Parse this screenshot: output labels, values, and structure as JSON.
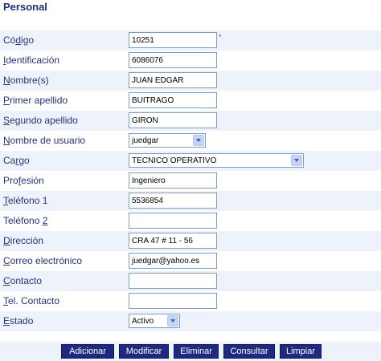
{
  "page": {
    "title": "Personal"
  },
  "form": {
    "codigo": {
      "label_pre": "Có",
      "label_u": "d",
      "label_post": "igo",
      "value": "10251",
      "required_mark": "*"
    },
    "identificacion": {
      "label_pre": "",
      "label_u": "I",
      "label_post": "dentificación",
      "value": "6086076"
    },
    "nombres": {
      "label_pre": "",
      "label_u": "N",
      "label_post": "ombre(s)",
      "value": "JUAN EDGAR"
    },
    "primer_apellido": {
      "label_pre": "",
      "label_u": "P",
      "label_post": "rimer apellido",
      "value": "BUITRAGO"
    },
    "segundo_apellido": {
      "label_pre": "",
      "label_u": "S",
      "label_post": "egundo apellido",
      "value": "GIRON"
    },
    "usuario": {
      "label_pre": "",
      "label_u": "N",
      "label_post": "ombre de usuario",
      "value": "juedgar"
    },
    "cargo": {
      "label_pre": "Ca",
      "label_u": "r",
      "label_post": "go",
      "value": "TECNICO OPERATIVO"
    },
    "profesion": {
      "label_pre": "Pro",
      "label_u": "f",
      "label_post": "esión",
      "value": "Ingeniero"
    },
    "telefono1": {
      "label_pre": "",
      "label_u": "T",
      "label_post": "eléfono 1",
      "value": "5536854"
    },
    "telefono2": {
      "label_pre": "Teléfono ",
      "label_u": "2",
      "label_post": "",
      "value": ""
    },
    "direccion": {
      "label_pre": "",
      "label_u": "D",
      "label_post": "irección",
      "value": "CRA 47 # 11 - 56"
    },
    "correo": {
      "label_pre": "",
      "label_u": "C",
      "label_post": "orreo electrónico",
      "value": "juedgar@yahoo.es"
    },
    "contacto": {
      "label_pre": "",
      "label_u": "C",
      "label_post": "ontacto",
      "value": ""
    },
    "tel_contacto": {
      "label_pre": "",
      "label_u": "T",
      "label_post": "el. Contacto",
      "value": ""
    },
    "estado": {
      "label_pre": "",
      "label_u": "E",
      "label_post": "stado",
      "value": "Activo"
    }
  },
  "buttons": {
    "adicionar": "Adicionar",
    "modificar": "Modificar",
    "eliminar": "Eliminar",
    "consultar": "Consultar",
    "limpiar": "Limpiar"
  }
}
